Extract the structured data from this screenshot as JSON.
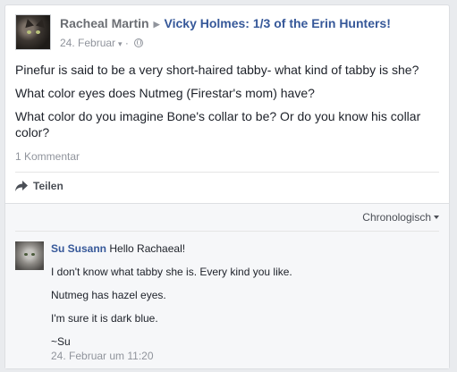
{
  "post": {
    "author": "Racheal Martin",
    "group": "Vicky Holmes: 1/3 of the Erin Hunters!",
    "date": "24. Februar",
    "paragraphs": [
      "Pinefur is said to be a very short-haired tabby- what kind of tabby is she?",
      "What color eyes does Nutmeg (Firestar's mom) have?",
      "What color do you imagine Bone's collar to be? Or do you know his collar color?"
    ],
    "comment_count": "1 Kommentar",
    "share_label": "Teilen"
  },
  "comments_section": {
    "sort_label": "Chronologisch",
    "comment": {
      "author": "Su Susann",
      "first_line": "Hello Rachaeal!",
      "lines": [
        "I don't know what tabby she is. Every kind you like.",
        "Nutmeg has hazel eyes.",
        "I'm sure it is dark blue.",
        "~Su"
      ],
      "timestamp": "24. Februar um 11:20"
    }
  },
  "colors": {
    "link": "#365899",
    "muted": "#90949c",
    "background": "#e9ebee"
  }
}
